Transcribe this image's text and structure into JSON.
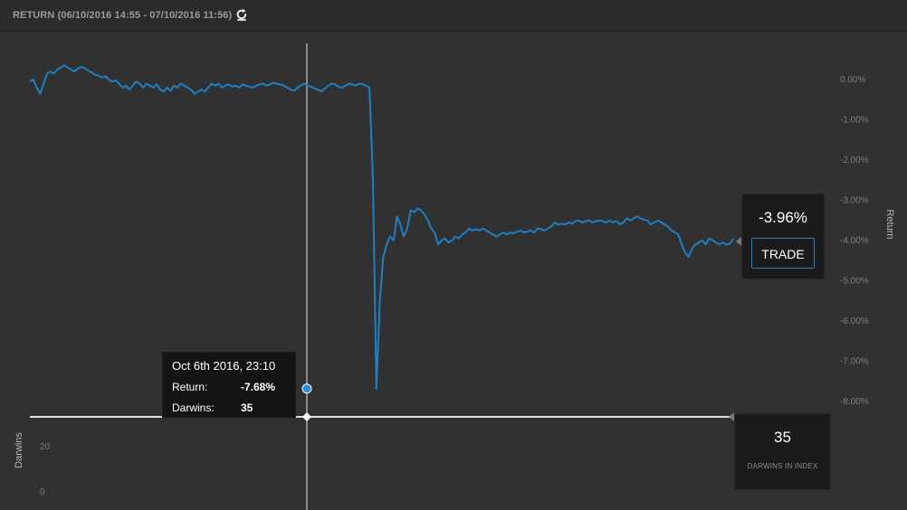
{
  "header": {
    "title": "RETURN (06/10/2016 14:55 - 07/10/2016 11:56)",
    "refresh_icon": "refresh-icon"
  },
  "tooltip": {
    "date": "Oct 6th 2016, 23:10",
    "return_label": "Return:",
    "return_value": "-7.68%",
    "darwins_label": "Darwins:",
    "darwins_value": "35"
  },
  "current": {
    "return_value": "-3.96%",
    "trade_label": "TRADE",
    "darwins_value": "35",
    "darwins_caption": "DARWINS IN INDEX"
  },
  "colors": {
    "line": "#1f7fc3",
    "background": "#313131",
    "marker": "#2a8ad6"
  },
  "chart_data": [
    {
      "type": "line",
      "ylabel": "Return",
      "yticks": [
        "0.00%",
        "-1.00%",
        "-2.00%",
        "-3.00%",
        "-4.00%",
        "-5.00%",
        "-6.00%",
        "-7.00%",
        "-8.00%"
      ],
      "ylim": [
        -8.4,
        0.5
      ],
      "grid": false,
      "hover": {
        "index": 101,
        "value": -7.68
      },
      "series": [
        {
          "values": [
            -0.05,
            0.0,
            -0.2,
            -0.35,
            -0.1,
            0.15,
            0.2,
            0.15,
            0.25,
            0.3,
            0.35,
            0.3,
            0.25,
            0.2,
            0.28,
            0.32,
            0.28,
            0.22,
            0.18,
            0.12,
            0.1,
            0.05,
            0.08,
            0.0,
            -0.05,
            -0.02,
            -0.1,
            -0.2,
            -0.15,
            -0.25,
            -0.15,
            -0.05,
            -0.1,
            -0.2,
            -0.1,
            -0.15,
            -0.2,
            -0.12,
            -0.25,
            -0.3,
            -0.2,
            -0.28,
            -0.15,
            -0.2,
            -0.1,
            -0.15,
            -0.2,
            -0.25,
            -0.35,
            -0.3,
            -0.25,
            -0.3,
            -0.2,
            -0.1,
            -0.15,
            -0.1,
            -0.2,
            -0.15,
            -0.12,
            -0.18,
            -0.15,
            -0.2,
            -0.12,
            -0.15,
            -0.18,
            -0.2,
            -0.15,
            -0.12,
            -0.1,
            -0.15,
            -0.12,
            -0.08,
            -0.1,
            -0.12,
            -0.15,
            -0.2,
            -0.25,
            -0.28,
            -0.2,
            -0.15,
            -0.1,
            -0.15,
            -0.18,
            -0.22,
            -0.25,
            -0.3,
            -0.22,
            -0.15,
            -0.1,
            -0.12,
            -0.18,
            -0.2,
            -0.15,
            -0.1,
            -0.12,
            -0.15,
            -0.1,
            -0.12,
            -0.15,
            -0.2,
            -2.5,
            -7.68,
            -5.5,
            -4.4,
            -4.1,
            -3.9,
            -4.0,
            -3.4,
            -3.6,
            -3.9,
            -3.7,
            -3.25,
            -3.3,
            -3.2,
            -3.25,
            -3.35,
            -3.5,
            -3.7,
            -3.8,
            -4.1,
            -4.0,
            -3.95,
            -4.05,
            -4.0,
            -3.9,
            -3.95,
            -3.85,
            -3.8,
            -3.7,
            -3.75,
            -3.72,
            -3.75,
            -3.7,
            -3.75,
            -3.8,
            -3.85,
            -3.9,
            -3.85,
            -3.8,
            -3.85,
            -3.8,
            -3.82,
            -3.78,
            -3.75,
            -3.8,
            -3.78,
            -3.75,
            -3.8,
            -3.7,
            -3.72,
            -3.75,
            -3.7,
            -3.65,
            -3.55,
            -3.6,
            -3.58,
            -3.6,
            -3.55,
            -3.58,
            -3.52,
            -3.5,
            -3.55,
            -3.52,
            -3.5,
            -3.55,
            -3.52,
            -3.5,
            -3.52,
            -3.55,
            -3.5,
            -3.55,
            -3.52,
            -3.6,
            -3.55,
            -3.45,
            -3.5,
            -3.45,
            -3.4,
            -3.45,
            -3.48,
            -3.5,
            -3.6,
            -3.55,
            -3.5,
            -3.55,
            -3.6,
            -3.65,
            -3.75,
            -3.8,
            -3.85,
            -4.1,
            -4.3,
            -4.4,
            -4.2,
            -4.1,
            -4.05,
            -4.0,
            -4.1,
            -3.95,
            -4.0,
            -4.05,
            -4.1,
            -4.05,
            -4.1,
            -4.08,
            -3.96
          ]
        }
      ]
    },
    {
      "type": "line",
      "ylabel": "Darwins",
      "yticks": [
        "20",
        "0"
      ],
      "series": [
        {
          "values": [
            35,
            35
          ]
        }
      ]
    }
  ]
}
